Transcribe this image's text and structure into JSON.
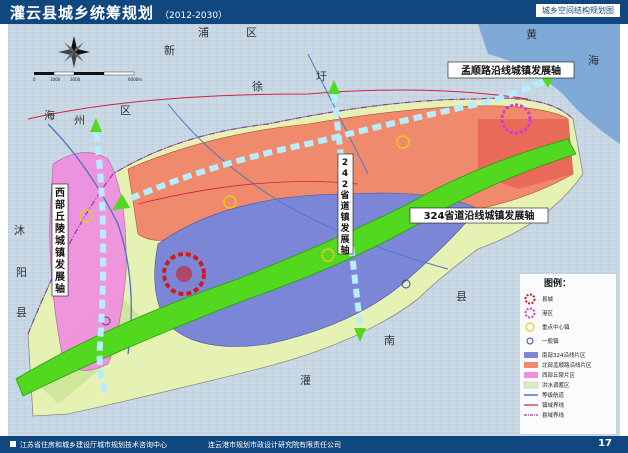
{
  "header": {
    "title": "灌云县城乡统筹规划",
    "years": "（2012-2030）",
    "subtitle": "城乡空间结构规划图"
  },
  "footer": {
    "left": "江苏省住房和城乡建设厅城市规划技术咨询中心",
    "center": "连云港市规划市政设计研究院有限责任公司",
    "page": "17"
  },
  "axes": {
    "a1": "孟顺路沿线城镇发展轴",
    "a2_chars": [
      "2",
      "4",
      "2",
      "省",
      "道",
      "镇",
      "发",
      "展",
      "轴"
    ],
    "a3": "324省道沿线城镇发展轴",
    "a4_chars": [
      "西",
      "部",
      "丘",
      "陵",
      "城",
      "镇",
      "发",
      "展",
      "轴"
    ]
  },
  "places": [
    "海",
    "州",
    "区",
    "沐",
    "阳",
    "县",
    "新",
    "浦",
    "区",
    "徐",
    "圩",
    "黄",
    "海",
    "南",
    "县",
    "灌"
  ],
  "legend": {
    "title": "图例：",
    "items": [
      "县城",
      "港区",
      "重点中心镇",
      "一般镇",
      "南部324沿线片区",
      "北部孟顺路沿线片区",
      "西部丘陵片区",
      "洪水调蓄区",
      "等级航道",
      "镇域界线",
      "县域界线"
    ],
    "colors": {
      "south_324": "#7b87d6",
      "north_mengshun": "#f08a6c",
      "west_hills": "#f08ee0",
      "flood": "#dcecc8",
      "axis_green": "#52d81e",
      "axis_arrow": "#b8ecff"
    }
  },
  "scale": {
    "ticks": [
      "0",
      "1000",
      "3000",
      "6000m"
    ]
  },
  "icons": [
    "compass-rose-icon",
    "county-seat-icon",
    "port-icon",
    "key-town-icon",
    "general-town-icon"
  ]
}
